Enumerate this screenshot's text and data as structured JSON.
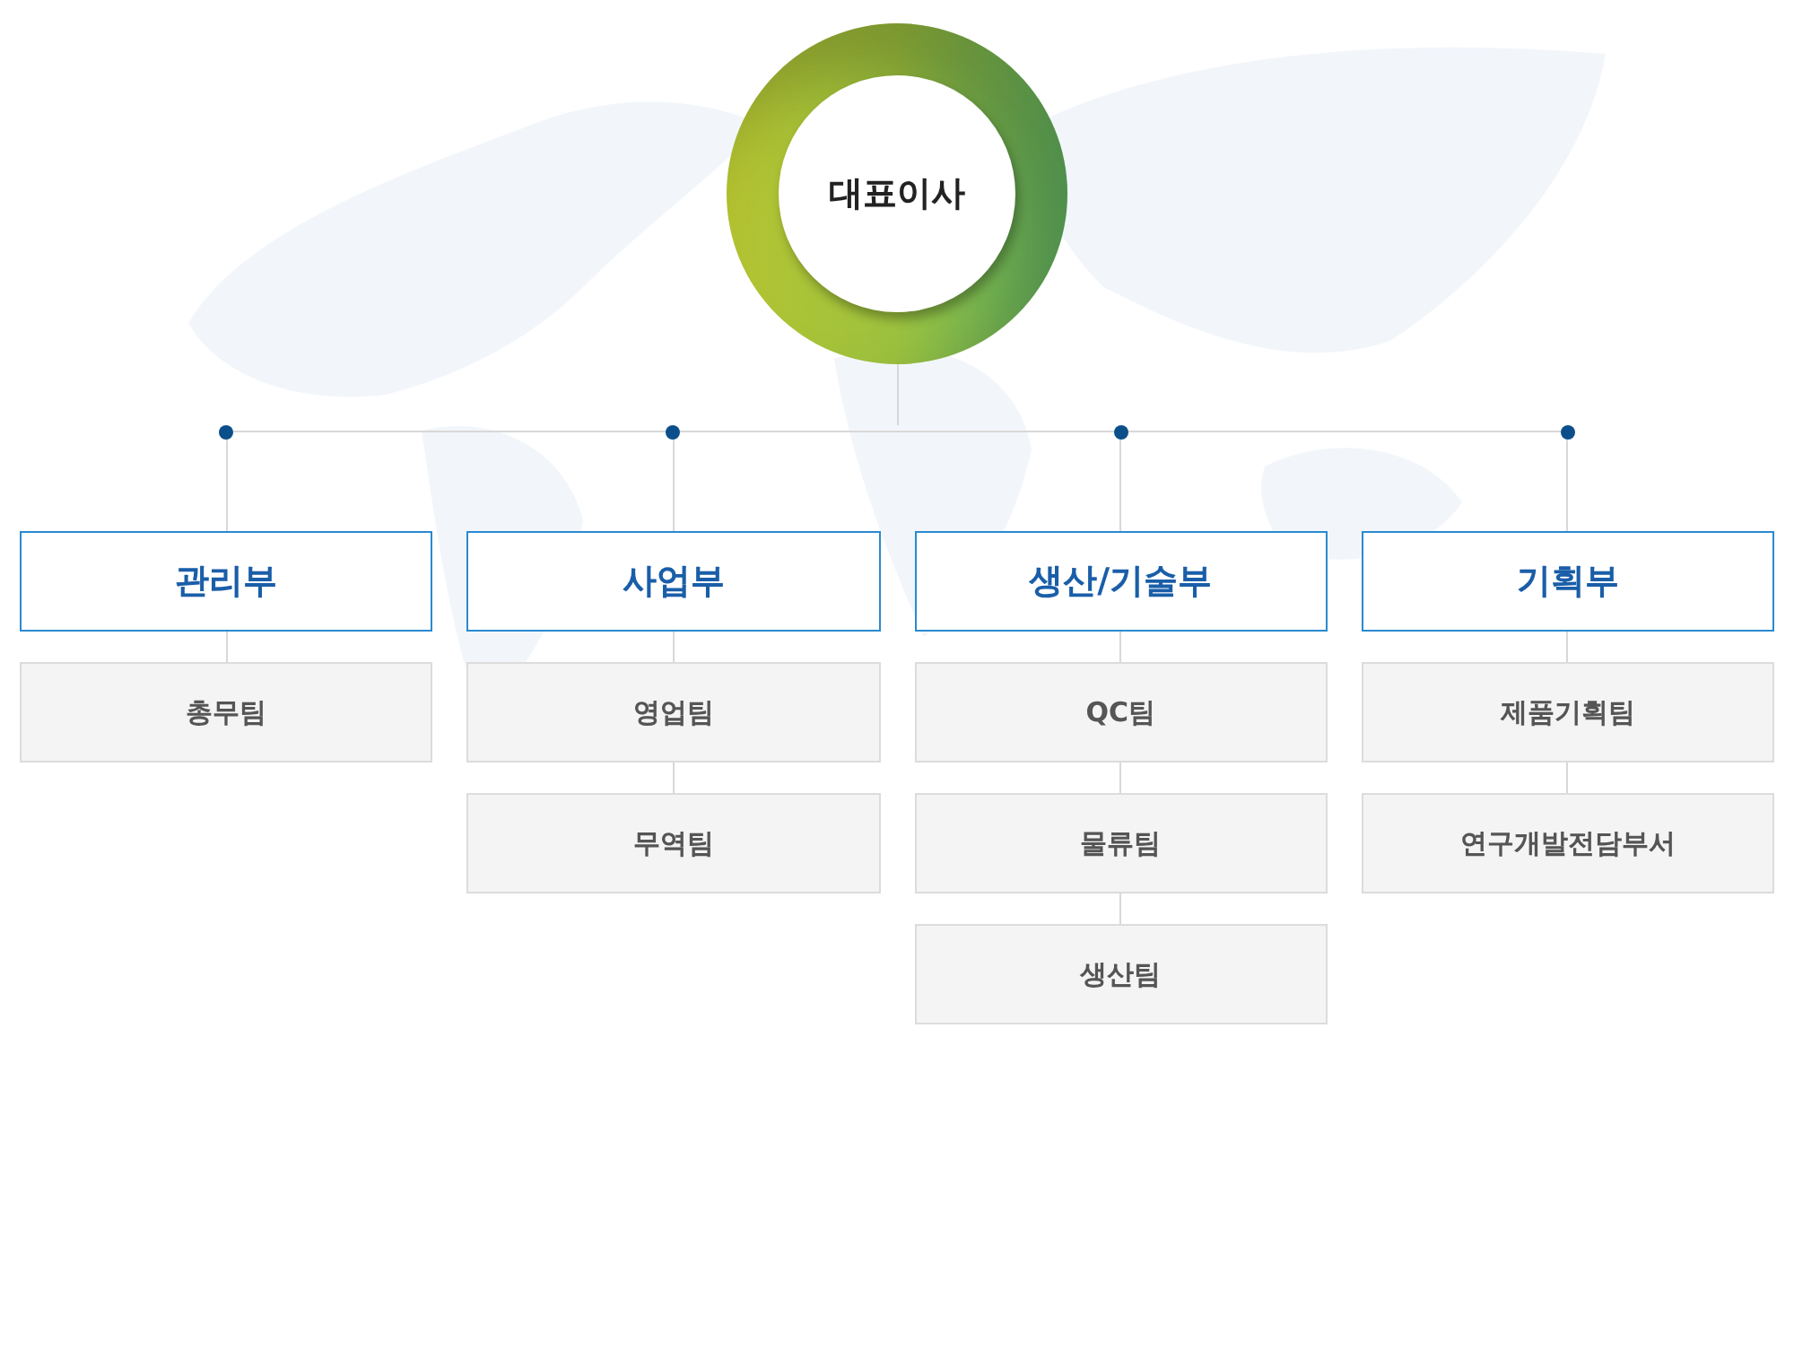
{
  "root": {
    "label": "대표이사"
  },
  "departments": [
    {
      "label": "관리부",
      "teams": [
        "총무팀"
      ]
    },
    {
      "label": "사업부",
      "teams": [
        "영업팀",
        "무역팀"
      ]
    },
    {
      "label": "생산/기술부",
      "teams": [
        "QC팀",
        "물류팀",
        "생산팀"
      ]
    },
    {
      "label": "기획부",
      "teams": [
        "제품기획팀",
        "연구개발전담부서"
      ]
    }
  ]
}
